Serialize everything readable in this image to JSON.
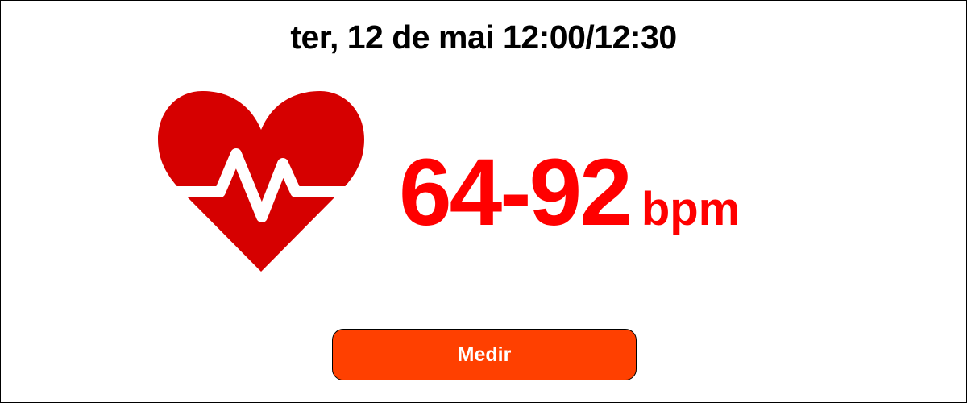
{
  "header": {
    "title": "ter, 12 de mai 12:00/12:30"
  },
  "heart_rate": {
    "icon": "heart-pulse-icon",
    "value": "64-92",
    "unit": "bpm"
  },
  "actions": {
    "measure_label": "Medir"
  },
  "colors": {
    "heart": "#d60000",
    "reading": "#ff0000",
    "button": "#ff4000",
    "button_text": "#ffffff"
  }
}
